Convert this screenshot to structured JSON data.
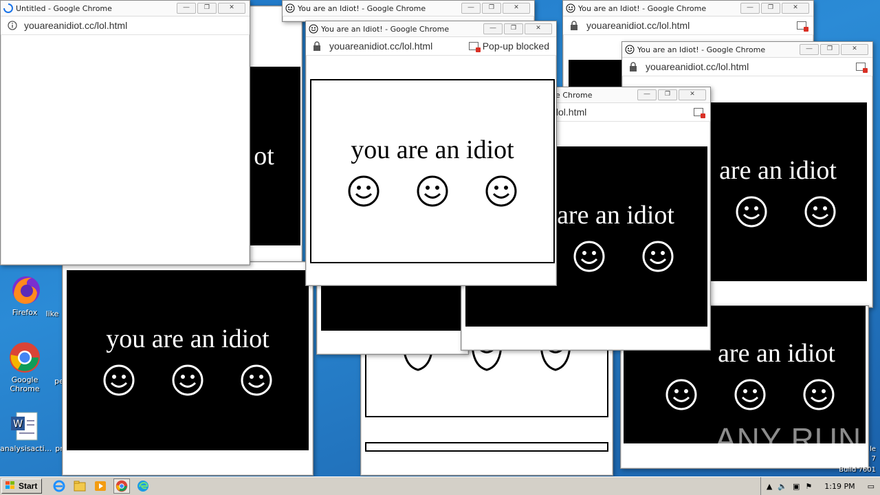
{
  "desktop": {
    "icons": [
      {
        "label": "Firefox"
      },
      {
        "label": "Google Chrome"
      },
      {
        "label": "analysisacti..."
      }
    ],
    "partial_labels": [
      "like",
      "pe",
      "pr"
    ],
    "os_lines": [
      "le",
      "7",
      "Build 7601"
    ],
    "watermark": "ANY RUN"
  },
  "windows": {
    "untitled": {
      "title": "Untitled - Google Chrome",
      "url": "youareanidiot.cc/lol.html"
    },
    "main": {
      "title": "You are an Idiot! - Google Chrome",
      "url": "youareanidiot.cc/lol.html",
      "popup_blocked": "Pop-up blocked"
    },
    "topmid": {
      "title": "You are an Idiot! - Google Chrome"
    },
    "topright": {
      "title": "You are an Idiot! - Google Chrome",
      "url": "youareanidiot.cc/lol.html"
    },
    "right": {
      "title": "You are an Idiot! - Google Chrome",
      "url": "youareanidiot.cc/lol.html"
    },
    "center": {
      "title_fragment": "le Chrome",
      "url_fragment": "/lol.html"
    }
  },
  "message": "you are an idiot",
  "message_fragments": {
    "ot": "ot",
    "are_an_idiot": "are an idiot"
  },
  "taskbar": {
    "start_label": "Start",
    "clock": "1:19 PM"
  }
}
